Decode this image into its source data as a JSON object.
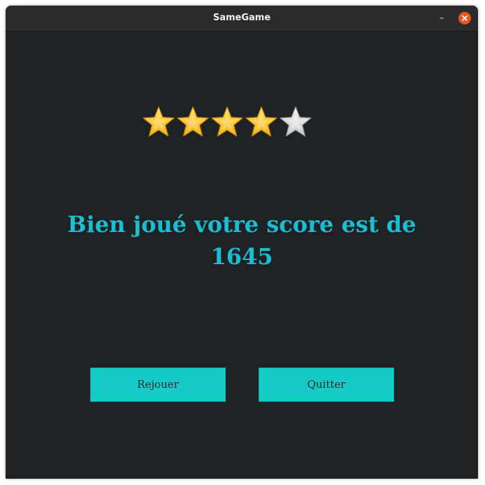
{
  "window": {
    "title": "SameGame",
    "minimize_label": "–"
  },
  "rating": {
    "filled": 4,
    "total": 5,
    "filled_color": "#f5b51b",
    "empty_color": "#c8c8c8"
  },
  "result": {
    "message_line1": "Bien joué votre score est de",
    "score": "1645"
  },
  "buttons": {
    "replay_label": "Rejouer",
    "quit_label": "Quitter"
  }
}
